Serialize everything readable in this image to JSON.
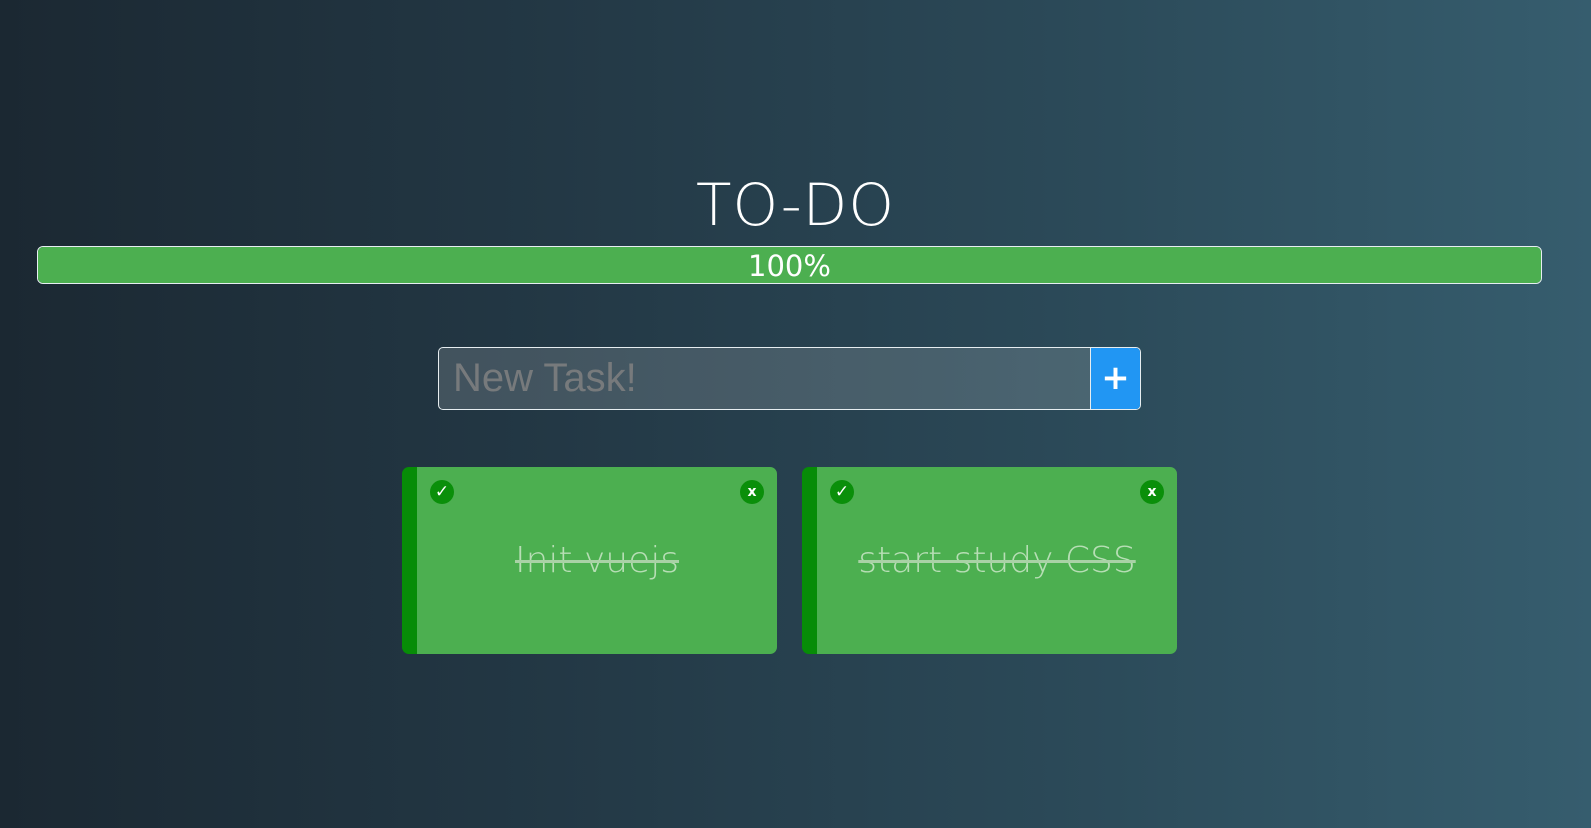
{
  "app": {
    "title": "TO-DO"
  },
  "progress": {
    "label": "100%",
    "value": 1.0,
    "fill_color": "#4caf50"
  },
  "new_task": {
    "placeholder": "New Task!",
    "value": "",
    "add_label": "+",
    "add_color": "#2196f3"
  },
  "tasks": [
    {
      "text": "Init vuejs",
      "done": true,
      "check_icon": "✓",
      "close_label": "x"
    },
    {
      "text": "start study CSS",
      "done": true,
      "check_icon": "✓",
      "close_label": "x"
    }
  ],
  "colors": {
    "task_bg": "#4caf50",
    "task_accent": "#078c07"
  }
}
